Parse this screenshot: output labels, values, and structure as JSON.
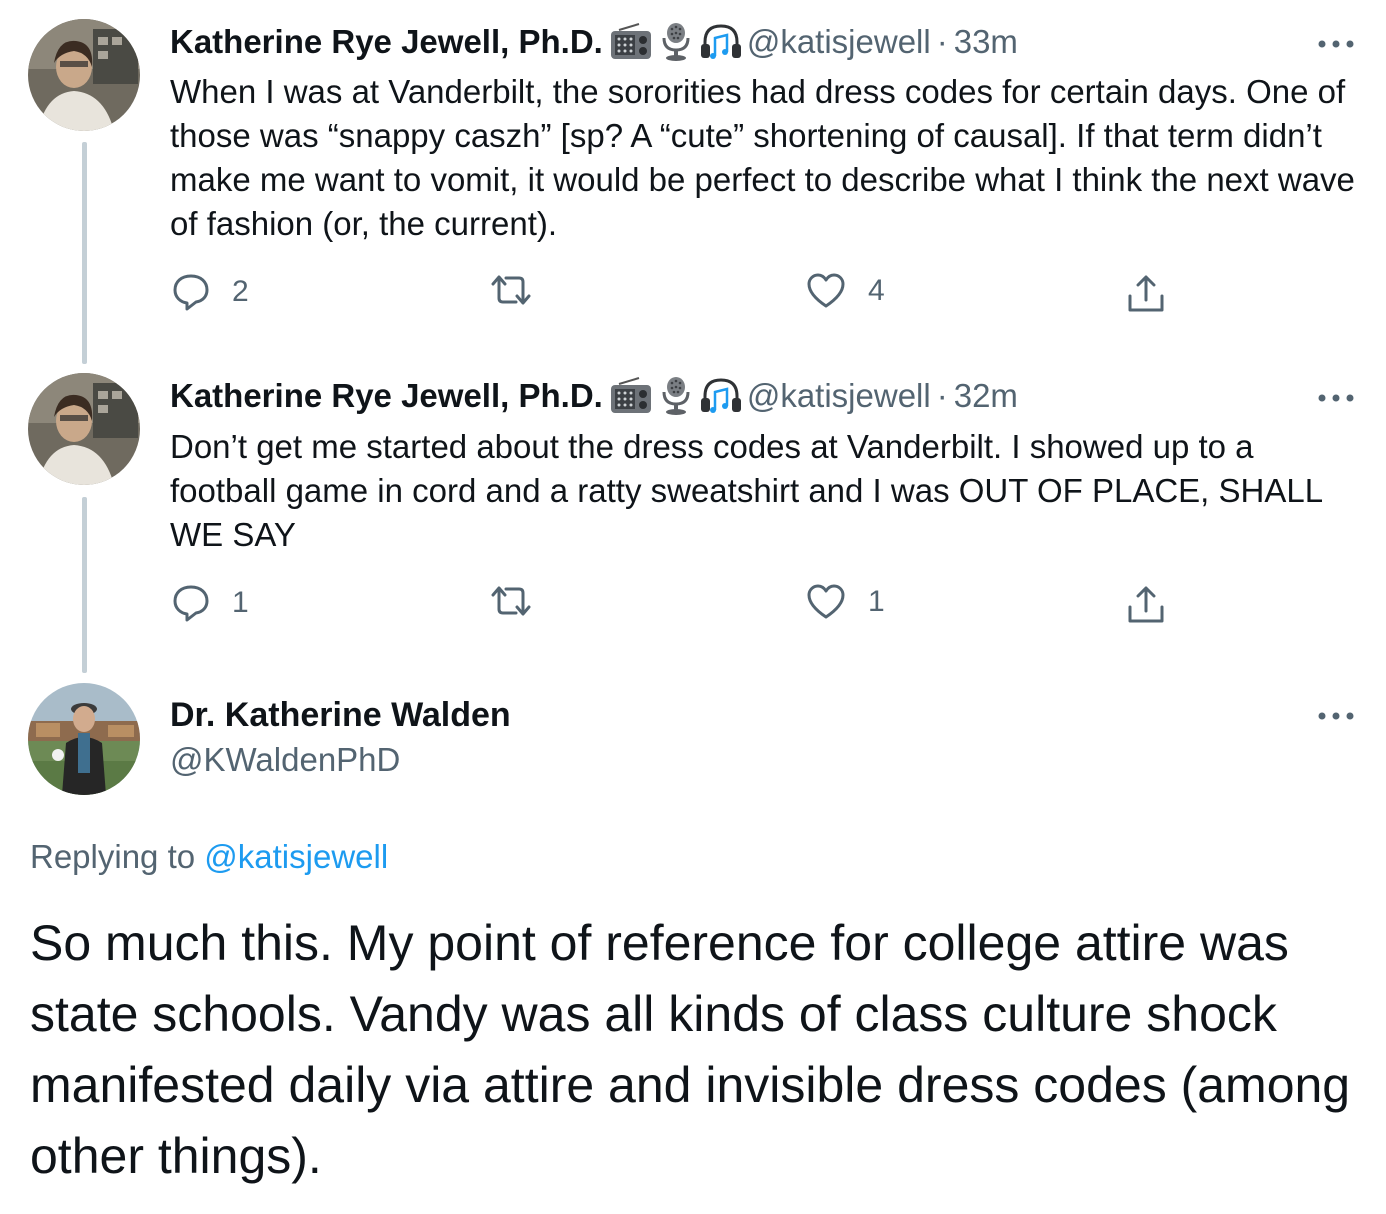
{
  "thread": [
    {
      "author_name": "Katherine Rye Jewell, Ph.D.",
      "author_emojis": [
        "radio-icon",
        "microphone-icon",
        "headphones-icon"
      ],
      "handle": "@katisjewell",
      "separator": "·",
      "time": "33m",
      "text": "When I was at Vanderbilt, the sororities had dress codes for certain days. One of those was “snappy caszh” [sp? A “cute” shortening of causal]. If that term didn’t make me want to vomit, it would be perfect to describe what I think the next wave of fashion (or, the current).",
      "reply_count": "2",
      "like_count": "4"
    },
    {
      "author_name": "Katherine Rye Jewell, Ph.D.",
      "author_emojis": [
        "radio-icon",
        "microphone-icon",
        "headphones-icon"
      ],
      "handle": "@katisjewell",
      "separator": "·",
      "time": "32m",
      "text": "Don’t get me started about the dress codes at Vanderbilt. I showed up to a football game in cord and a ratty sweatshirt and I was OUT OF PLACE, SHALL WE SAY",
      "reply_count": "1",
      "like_count": "1"
    }
  ],
  "main_tweet": {
    "author_name": "Dr. Katherine Walden",
    "handle": "@KWaldenPhD",
    "replying_prefix": "Replying to",
    "replying_to": "@katisjewell",
    "text": "So much this. My point of reference for college attire was state schools. Vandy was all kinds of class culture shock manifested daily via attire and invisible dress codes (among other things)."
  },
  "colors": {
    "text_primary": "#0f1419",
    "text_secondary": "#536471",
    "link": "#1d9bf0",
    "thread_line": "#c4cfd6"
  }
}
